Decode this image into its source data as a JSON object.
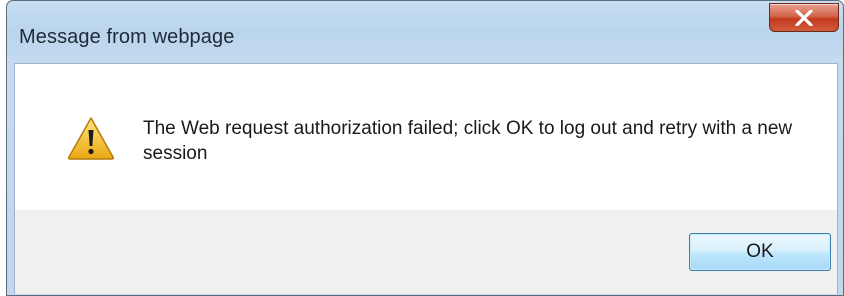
{
  "window": {
    "title": "Message from webpage",
    "close_icon": "close-x-icon"
  },
  "dialog": {
    "icon": "warning-icon",
    "message": "The Web request authorization failed; click OK to log out and retry with a new session",
    "ok_label": "OK"
  },
  "colors": {
    "titlebar": "#c4dbef",
    "close_button": "#c23b20",
    "ok_button": "#bee6fd",
    "button_bar": "#f0f0f0",
    "warning_fill": "#f5c23a"
  }
}
